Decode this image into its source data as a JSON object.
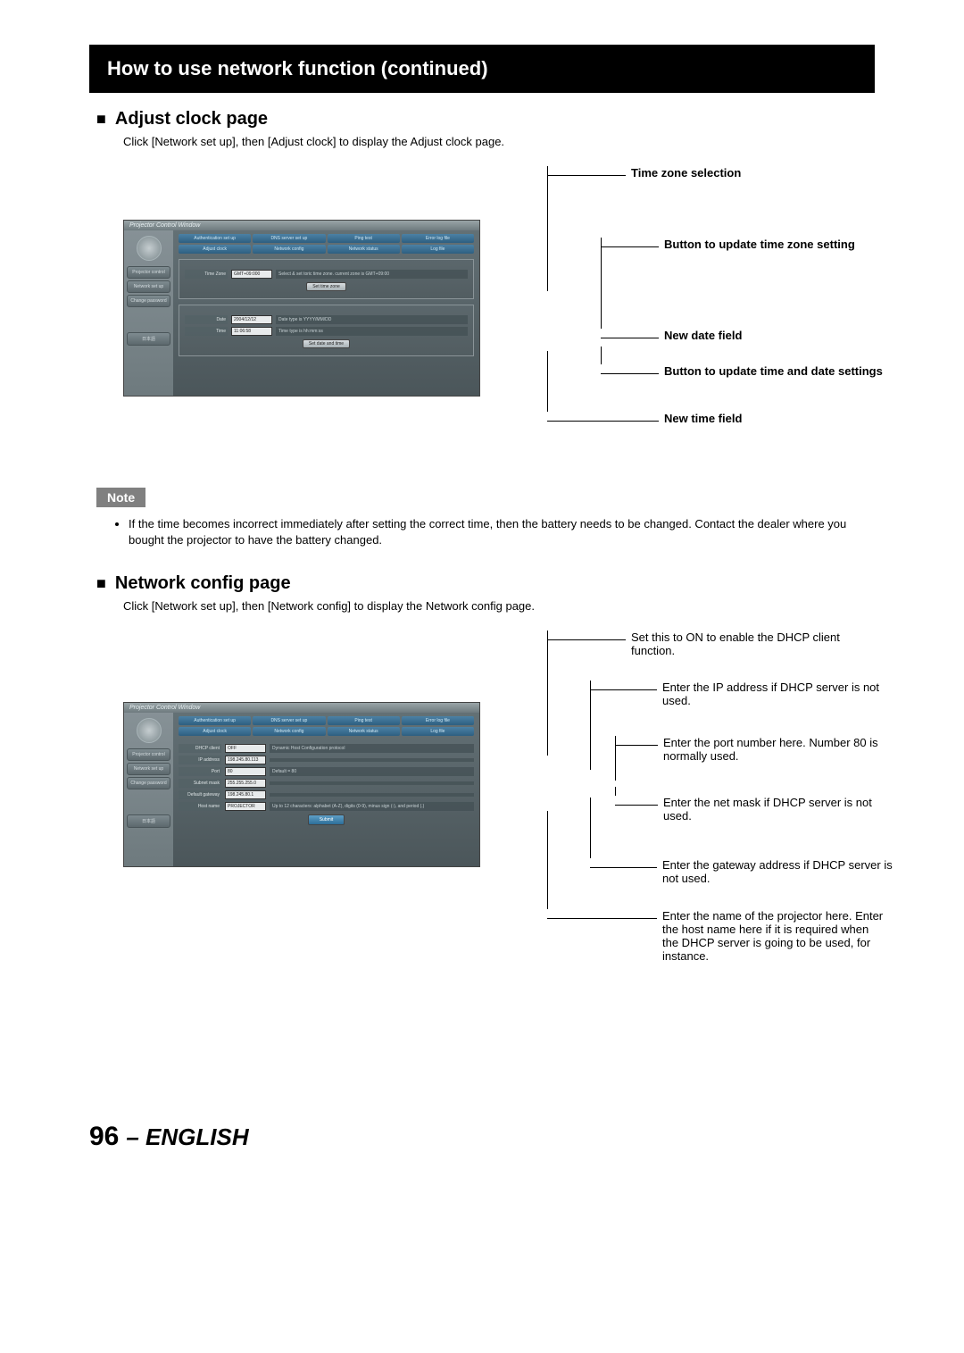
{
  "title": "How to use network function (continued)",
  "section1": {
    "heading": "Adjust clock page",
    "desc": "Click [Network set up], then [Adjust clock] to display the Adjust clock page."
  },
  "section2": {
    "heading": "Network config page",
    "desc": "Click [Network set up], then [Network config] to display the Network config page."
  },
  "note_badge": "Note",
  "note_text": "If the time becomes incorrect immediately after setting the correct time, then the battery needs to be changed. Contact the dealer where you bought the projector to have the battery changed.",
  "annot1": {
    "a": "Time zone selection",
    "b": "Button to update time zone setting",
    "c": "New date field",
    "d": "Button to update time and date settings",
    "e": "New time field"
  },
  "annot2": {
    "a": "Set this to ON to enable the DHCP client function.",
    "b": "Enter the IP address if DHCP server is not used.",
    "c": "Enter the port number here. Number 80 is normally used.",
    "d": "Enter the net mask if DHCP server is not used.",
    "e": "Enter the gateway address if DHCP server is not used.",
    "f": "Enter the name of the projector here. Enter the host name here if it is required when the DHCP server is going to be used, for instance."
  },
  "proj": {
    "window_title": "Projector Control Window",
    "tabs1": [
      "Authentication set up",
      "DNS server set up",
      "Ping test",
      "Error log file"
    ],
    "tabs2": [
      "Adjust clock",
      "Network config",
      "Network status",
      "Log file"
    ],
    "side": {
      "projector": "Projector control",
      "network": "Network set up",
      "change": "Change password",
      "jp": "日本語"
    },
    "clock": {
      "tz_label": "Time Zone",
      "tz_value": "GMT+09:000",
      "tz_hint": "Select & set toric time zone.\ncurrent zone is GMT+09:00",
      "set_tz": "Set time zone",
      "date_label": "Date",
      "date_value": "2004/12/12",
      "date_hint": "Date type is YYYY/MM/DD",
      "time_label": "Time",
      "time_value": "11:06:58",
      "time_hint": "Time type is hh:mm:ss",
      "set_dt": "Set date and time"
    },
    "net": {
      "dhcp_label": "DHCP client",
      "dhcp_value": "OFF",
      "dhcp_hint": "Dynamic Host Configuration protocol",
      "ip_label": "IP address",
      "ip_value": "198.245.80.113",
      "port_label": "Port",
      "port_value": "80",
      "port_hint": "Default = 80",
      "mask_label": "Subnet mask",
      "mask_value": "255.255.255.0",
      "gw_label": "Default gateway",
      "gw_value": "198.245.80.1",
      "host_label": "Host name",
      "host_value": "PROJECTOR",
      "host_hint": "Up to 12 characters: alphabet (A-Z), digits (0-9), minus sign (-), and period (.)",
      "submit": "Submit"
    }
  },
  "footer": {
    "page": "96",
    "lang": "– ENGLISH"
  }
}
